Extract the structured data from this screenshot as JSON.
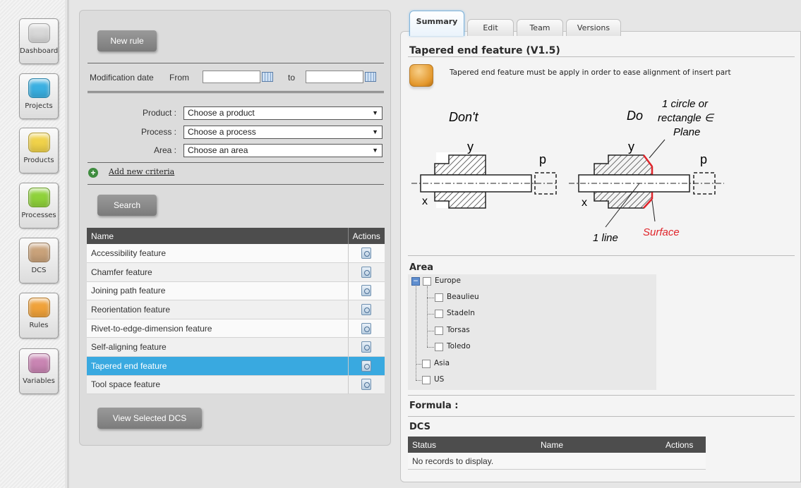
{
  "nav": {
    "items": [
      {
        "label": "Dashboard",
        "icon": "dashboard-icon",
        "color": "#d8d8d8"
      },
      {
        "label": "Projects",
        "icon": "projects-icon",
        "color": "#3ab0e2"
      },
      {
        "label": "Products",
        "icon": "products-icon",
        "color": "#f0d24a"
      },
      {
        "label": "Processes",
        "icon": "processes-icon",
        "color": "#8fd23a"
      },
      {
        "label": "DCS",
        "icon": "dcs-icon",
        "color": "#c9a27a"
      },
      {
        "label": "Rules",
        "icon": "rules-icon",
        "color": "#f0a23a"
      },
      {
        "label": "Variables",
        "icon": "variables-icon",
        "color": "#c985b3"
      }
    ]
  },
  "left": {
    "new_rule_label": "New rule",
    "modification_date_label": "Modification date",
    "from_label": "From",
    "to_label": "to",
    "from_value": "",
    "to_value": "",
    "filters": [
      {
        "label": "Product :",
        "value": "Choose a product"
      },
      {
        "label": "Process :",
        "value": "Choose a process"
      },
      {
        "label": "Area :",
        "value": "Choose an area"
      }
    ],
    "add_criteria_label": "Add new criteria",
    "search_label": "Search",
    "grid": {
      "headers": {
        "name": "Name",
        "actions": "Actions"
      },
      "rows": [
        {
          "name": "Accessibility feature",
          "selected": false
        },
        {
          "name": "Chamfer feature",
          "selected": false
        },
        {
          "name": "Joining path feature",
          "selected": false
        },
        {
          "name": "Reorientation feature",
          "selected": false
        },
        {
          "name": "Rivet-to-edge-dimension feature",
          "selected": false
        },
        {
          "name": "Self-aligning feature",
          "selected": false
        },
        {
          "name": "Tapered end feature",
          "selected": true
        },
        {
          "name": "Tool space feature",
          "selected": false
        }
      ]
    },
    "view_selected_label": "View Selected DCS"
  },
  "right": {
    "tabs": [
      {
        "label": "Summary",
        "active": true
      },
      {
        "label": "Edit",
        "active": false
      },
      {
        "label": "Team",
        "active": false
      },
      {
        "label": "Versions",
        "active": false
      }
    ],
    "title": "Tapered end feature (V1.5)",
    "description": "Tapered end feature must be apply in order to ease alignment of insert part",
    "diagram": {
      "dont_label": "Don't",
      "do_label": "Do",
      "y_label": "y",
      "p_label": "p",
      "x_label": "x",
      "annotation_line1": "1 circle or",
      "annotation_line2": "rectangle ∈",
      "annotation_line3": "Plane",
      "line_label": "1 line",
      "surface_label": "Surface",
      "surface_color": "#e0242a"
    },
    "area_label": "Area",
    "area_tree": {
      "root": "Europe",
      "europe_children": [
        "Beaulieu",
        "Stadeln",
        "Torsas",
        "Toledo"
      ],
      "others": [
        "Asia",
        "US"
      ]
    },
    "formula_label": "Formula :",
    "dcs_label": "DCS",
    "dcs_table": {
      "headers": {
        "status": "Status",
        "name": "Name",
        "actions": "Actions"
      },
      "empty_text": "No records to display."
    }
  }
}
